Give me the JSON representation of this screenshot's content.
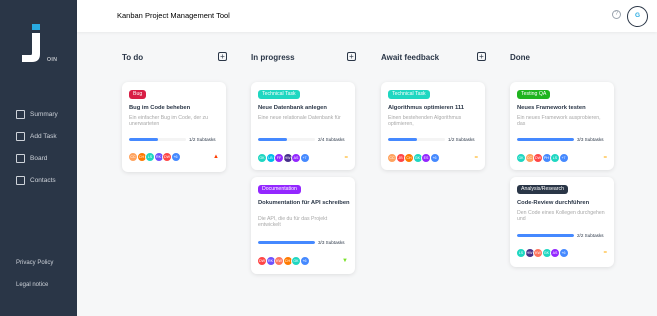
{
  "app": {
    "title": "Kanban Project Management Tool",
    "logo_text": "OIN"
  },
  "user": {
    "initials": "G"
  },
  "help": {
    "glyph": "?"
  },
  "nav": [
    {
      "label": "Summary",
      "icon": "summary-icon"
    },
    {
      "label": "Add Task",
      "icon": "add-task-icon"
    },
    {
      "label": "Board",
      "icon": "board-icon"
    },
    {
      "label": "Contacts",
      "icon": "contacts-icon"
    }
  ],
  "footer": {
    "privacy": "Privacy Policy",
    "legal": "Legal notice"
  },
  "columns": [
    {
      "title": "To do",
      "add": "+"
    },
    {
      "title": "In progress",
      "add": "+"
    },
    {
      "title": "Await feedback",
      "add": "+"
    },
    {
      "title": "Done"
    }
  ],
  "cards": [
    {
      "tag": "Bug",
      "tag_color": "#d81e45",
      "title": "Bug im Code beheben",
      "desc": "Ein einfacher Bug im Code, der zu unerwarteten",
      "progress": 0.5,
      "subtasks": "1/2 Subtasks",
      "priority": "urgent",
      "priority_color": "#ff3d00",
      "avatars": [
        {
          "i": "CC",
          "c": "#ffa35e"
        },
        {
          "i": "CH",
          "c": "#ff7a00"
        },
        {
          "i": "LS",
          "c": "#1fd7c1"
        },
        {
          "i": "RK",
          "c": "#6e52ff"
        },
        {
          "i": "DW",
          "c": "#ff4646"
        },
        {
          "i": "+6",
          "c": "#4589ff"
        }
      ]
    },
    {
      "tag": "Technical Task",
      "tag_color": "#1fd7c1",
      "title": "Neue Datenbank anlegen",
      "desc": "Eine neue relationale Datenbank für",
      "progress": 0.5,
      "subtasks": "2/4 Subtasks",
      "priority": "medium",
      "priority_color": "#ffa800",
      "avatars": [
        {
          "i": "GK",
          "c": "#1fd7c1"
        },
        {
          "i": "LB",
          "c": "#00bee8"
        },
        {
          "i": "FF",
          "c": "#9327ff"
        },
        {
          "i": "HW",
          "c": "#462f8a"
        },
        {
          "i": "AS",
          "c": "#9327ff"
        },
        {
          "i": "+7",
          "c": "#4589ff"
        }
      ]
    },
    {
      "tag": "Documentation",
      "tag_color": "#9327ff",
      "title": "Dokumentation für API schreiben",
      "desc": "Die API, die du für das Projekt entwickelt",
      "progress": 1.0,
      "subtasks": "3/3 Subtasks",
      "priority": "low",
      "priority_color": "#7ae229",
      "avatars": [
        {
          "i": "DW",
          "c": "#ff4646"
        },
        {
          "i": "RK",
          "c": "#6e52ff"
        },
        {
          "i": "KW",
          "c": "#ff745e"
        },
        {
          "i": "CH",
          "c": "#ff7a00"
        },
        {
          "i": "GK",
          "c": "#1fd7c1"
        },
        {
          "i": "+6",
          "c": "#4589ff"
        }
      ]
    },
    {
      "tag": "Technical Task",
      "tag_color": "#1fd7c1",
      "title": "Algorithmus optimieren 111",
      "desc": "Einen bestehenden Algorithmus optimieren,",
      "progress": 0.5,
      "subtasks": "1/2 Subtasks",
      "priority": "medium",
      "priority_color": "#ffa800",
      "avatars": [
        {
          "i": "CC",
          "c": "#ffa35e"
        },
        {
          "i": "JB",
          "c": "#ff4646"
        },
        {
          "i": "CH",
          "c": "#ff7a00"
        },
        {
          "i": "GK",
          "c": "#1fd7c1"
        },
        {
          "i": "ES",
          "c": "#9327ff"
        },
        {
          "i": "+6",
          "c": "#4589ff"
        }
      ]
    },
    {
      "tag": "Testing QA",
      "tag_color": "#1fb41f",
      "title": "Neues Framework testen",
      "desc": "Ein neues Framework ausprobieren, das",
      "progress": 1.0,
      "subtasks": "3/3 Subtasks",
      "priority": "medium",
      "priority_color": "#ffa800",
      "avatars": [
        {
          "i": "GK",
          "c": "#1fd7c1"
        },
        {
          "i": "CC",
          "c": "#ffa35e"
        },
        {
          "i": "DW",
          "c": "#ff4646"
        },
        {
          "i": "PH",
          "c": "#4589ff"
        },
        {
          "i": "LS",
          "c": "#1fd7c1"
        },
        {
          "i": "+7",
          "c": "#4589ff"
        }
      ]
    },
    {
      "tag": "Analysis/Research",
      "tag_color": "#2a3647",
      "title": "Code-Review durchführen",
      "desc": "Den Code eines Kollegen durchgehen und",
      "progress": 1.0,
      "subtasks": "2/2 Subtasks",
      "priority": "medium",
      "priority_color": "#ffa800",
      "avatars": [
        {
          "i": "LS",
          "c": "#1fd7c1"
        },
        {
          "i": "HW",
          "c": "#462f8a"
        },
        {
          "i": "KW",
          "c": "#ff745e"
        },
        {
          "i": "GK",
          "c": "#1fd7c1"
        },
        {
          "i": "AS",
          "c": "#9327ff"
        },
        {
          "i": "+6",
          "c": "#4589ff"
        }
      ]
    }
  ]
}
